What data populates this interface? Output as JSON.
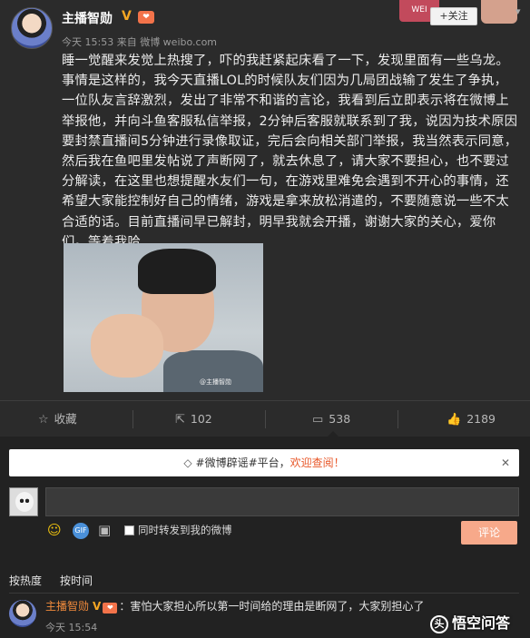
{
  "post": {
    "author": "主播智勋",
    "verified_badge": "V",
    "fan_badge": "❤",
    "meta": "今天 15:53 来自 微博 weibo.com",
    "follow_label": "+关注",
    "follow_deco_text": "WEI",
    "expand_icon": "chevron-down-icon",
    "content": "睡一觉醒来发觉上热搜了，吓的我赶紧起床看了一下，发现里面有一些乌龙。事情是这样的，我今天直播LOL的时候队友们因为几局团战输了发生了争执，一位队友言辞激烈，发出了非常不和谐的言论，我看到后立即表示将在微博上举报他，并向斗鱼客服私信举报，2分钟后客服就联系到了我，说因为技术原因要封禁直播间5分钟进行录像取证，完后会向相关部门举报，我当然表示同意，然后我在鱼吧里发帖说了声断网了，就去休息了，请大家不要担心，也不要过分解读，在这里也想提醒水友们一句，在游戏里难免会遇到不开心的事情，还希望大家能控制好自己的情绪，游戏是拿来放松消遣的，不要随意说一些不太合适的话。目前直播间早已解封，明早我就会开播，谢谢大家的关心，爱你们。等着我哈",
    "photo_watermark": "@主播智勋"
  },
  "actions": {
    "favorite_label": "收藏",
    "repost_count": "102",
    "comment_count": "538",
    "like_count": "2189"
  },
  "comments": {
    "notice_prefix": "#微博辟谣#平台，",
    "notice_highlight": "欢迎查阅！",
    "notice_close": "✕",
    "input_placeholder": "",
    "repost_checkbox_label": "同时转发到我的微博",
    "submit_label": "评论",
    "sort_hot": "按热度",
    "sort_time": "按时间",
    "items": [
      {
        "author": "主播智勋",
        "text": "：害怕大家担心所以第一时间给的理由是断网了，大家别担心了",
        "time": "今天 15:54"
      }
    ]
  },
  "watermark": {
    "text": "悟空问答",
    "mark": "头"
  },
  "colors": {
    "background": "#2b2b2b",
    "comment_bg": "#222222",
    "accent": "#f08a3c",
    "submit_bg": "#f7a98a"
  }
}
